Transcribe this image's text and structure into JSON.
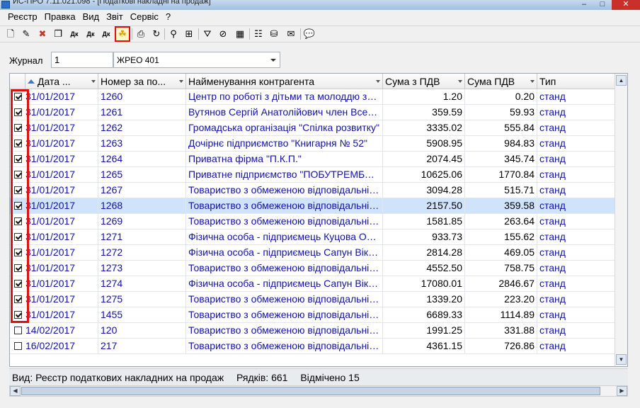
{
  "window": {
    "title": "ИС-ПРО 7.11.021.098 - [Податкові накладні на продаж]",
    "min": "–",
    "max": "□",
    "close": "✕"
  },
  "menu": [
    "Реєстр",
    "Правка",
    "Вид",
    "Звіт",
    "Сервіс",
    "?"
  ],
  "toolbar": {
    "icons": [
      "new-document-icon",
      "edit-icon",
      "delete-icon",
      "copy-icon",
      "debit-credit-icon",
      "debit-credit-down-icon",
      "debit-credit-up-icon",
      "group-icon",
      "print-icon",
      "refresh-icon",
      "find-icon",
      "tree-icon",
      "filter-icon",
      "clear-filter-icon",
      "grid-icon",
      "columns-icon",
      "database-icon",
      "mail-icon",
      "comment-icon"
    ],
    "glyphs": [
      "🗋",
      "✎",
      "✖",
      "❐",
      "Дк",
      "Дк",
      "Дк",
      "☘",
      "⎙",
      "↻",
      "⚲",
      "⊞",
      "⛛",
      "⊘",
      "▦",
      "☷",
      "⛁",
      "✉",
      "💬"
    ]
  },
  "journal": {
    "label": "Журнал",
    "code": "1",
    "name": "ЖРЕО 401"
  },
  "columns": [
    "Дата ...",
    "Номер за по...",
    "Найменування контрагента",
    "Сума з ПДВ",
    "Сума ПДВ",
    "Тип"
  ],
  "rows": [
    {
      "checked": true,
      "date": "31/01/2017",
      "num": "1260",
      "name": "Центр по роботі з дітьми та молоддю за місцем проживання",
      "sum": "1.20",
      "vat": "0.20",
      "type": "станд"
    },
    {
      "checked": true,
      "date": "31/01/2017",
      "num": "1261",
      "name": "Вутянов Сергій Анатолійович член Всеукраїнської спілки",
      "sum": "359.59",
      "vat": "59.93",
      "type": "станд"
    },
    {
      "checked": true,
      "date": "31/01/2017",
      "num": "1262",
      "name": "Громадська організація \"Спілка розвитку\"",
      "sum": "3335.02",
      "vat": "555.84",
      "type": "станд"
    },
    {
      "checked": true,
      "date": "31/01/2017",
      "num": "1263",
      "name": "Дочірнє підприємство \"Книгарня № 52\"",
      "sum": "5908.95",
      "vat": "984.83",
      "type": "станд"
    },
    {
      "checked": true,
      "date": "31/01/2017",
      "num": "1264",
      "name": "Приватна фірма \"П.К.П.\"",
      "sum": "2074.45",
      "vat": "345.74",
      "type": "станд"
    },
    {
      "checked": true,
      "date": "31/01/2017",
      "num": "1265",
      "name": "Приватне підприємство \"ПОБУТРЕМБУД\"",
      "sum": "10625.06",
      "vat": "1770.84",
      "type": "станд"
    },
    {
      "checked": true,
      "date": "31/01/2017",
      "num": "1267",
      "name": "Товариство з обмеженою відповідальністю",
      "sum": "3094.28",
      "vat": "515.71",
      "type": "станд"
    },
    {
      "checked": true,
      "date": "31/01/2017",
      "num": "1268",
      "name": "Товариство з обмеженою відповідальністю",
      "sum": "2157.50",
      "vat": "359.58",
      "type": "станд",
      "selected": true
    },
    {
      "checked": true,
      "date": "31/01/2017",
      "num": "1269",
      "name": "Товариство з обмеженою відповідальністю",
      "sum": "1581.85",
      "vat": "263.64",
      "type": "станд"
    },
    {
      "checked": true,
      "date": "31/01/2017",
      "num": "1271",
      "name": "Фізична особа - підприємець Куцова Олена",
      "sum": "933.73",
      "vat": "155.62",
      "type": "станд"
    },
    {
      "checked": true,
      "date": "31/01/2017",
      "num": "1272",
      "name": "Фізична особа - підприємець Сапун Віктор",
      "sum": "2814.28",
      "vat": "469.05",
      "type": "станд"
    },
    {
      "checked": true,
      "date": "31/01/2017",
      "num": "1273",
      "name": "Товариство з обмеженою відповідальністю",
      "sum": "4552.50",
      "vat": "758.75",
      "type": "станд"
    },
    {
      "checked": true,
      "date": "31/01/2017",
      "num": "1274",
      "name": "Фізична особа - підприємець Сапун Віктор",
      "sum": "17080.01",
      "vat": "2846.67",
      "type": "станд"
    },
    {
      "checked": true,
      "date": "31/01/2017",
      "num": "1275",
      "name": "Товариство з обмеженою відповідальністю",
      "sum": "1339.20",
      "vat": "223.20",
      "type": "станд"
    },
    {
      "checked": true,
      "date": "31/01/2017",
      "num": "1455",
      "name": "Товариство з обмеженою відповідальністю",
      "sum": "6689.33",
      "vat": "1114.89",
      "type": "станд"
    },
    {
      "checked": false,
      "date": "14/02/2017",
      "num": "120",
      "name": "Товариство з обмеженою відповідальністю",
      "sum": "1991.25",
      "vat": "331.88",
      "type": "станд"
    },
    {
      "checked": false,
      "date": "16/02/2017",
      "num": "217",
      "name": "Товариство з обмеженою відповідальністю",
      "sum": "4361.15",
      "vat": "726.86",
      "type": "станд"
    }
  ],
  "status": {
    "view": "Вид: Реєстр податкових накладних на продаж",
    "rows": "Рядків: 661",
    "marked": "Відмічено 15"
  },
  "colors": {
    "link": "#1111a8",
    "highlight": "#e01010",
    "selected_row": "#cfe3fb"
  }
}
